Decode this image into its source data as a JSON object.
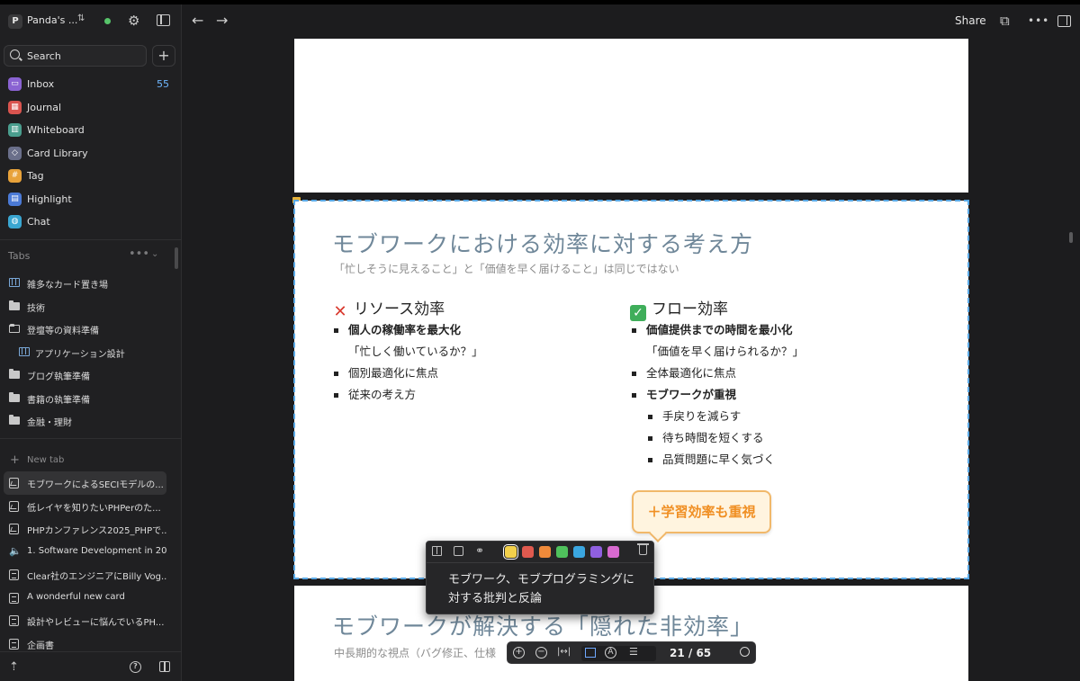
{
  "workspace": {
    "badge": "P",
    "name": "Panda's ...",
    "updown": "⇅",
    "status_color": "#57c46a"
  },
  "search": {
    "label": "Search",
    "add": "+"
  },
  "nav": [
    {
      "label": "Inbox",
      "icon": "inbox-icon",
      "color": "#8a63d2",
      "count": "55"
    },
    {
      "label": "Journal",
      "icon": "calendar-icon",
      "color": "#d9544f",
      "count": ""
    },
    {
      "label": "Whiteboard",
      "icon": "whiteboard-icon",
      "color": "#4a9e8e",
      "count": ""
    },
    {
      "label": "Card Library",
      "icon": "card-library-icon",
      "color": "#6a6f8a",
      "count": ""
    },
    {
      "label": "Tag",
      "icon": "tag-icon",
      "color": "#e8a23a",
      "count": ""
    },
    {
      "label": "Highlight",
      "icon": "highlight-icon",
      "color": "#4b7ad6",
      "count": ""
    },
    {
      "label": "Chat",
      "icon": "chat-icon",
      "color": "#3aa6d1",
      "count": ""
    }
  ],
  "tabs_section": {
    "title": "Tabs",
    "more": "•••",
    "collapse": "⌄"
  },
  "tabs": [
    {
      "label": "雑多なカード置き場",
      "kind": "map",
      "sub": false
    },
    {
      "label": "技術",
      "kind": "folder",
      "sub": false
    },
    {
      "label": "登壇等の資料準備",
      "kind": "folder-open",
      "sub": false
    },
    {
      "label": "アプリケーション設計",
      "kind": "map",
      "sub": true
    },
    {
      "label": "ブログ執筆準備",
      "kind": "folder",
      "sub": false
    },
    {
      "label": "書籍の執筆準備",
      "kind": "folder",
      "sub": false
    },
    {
      "label": "金融・理財",
      "kind": "folder",
      "sub": false
    }
  ],
  "new_tab": {
    "plus": "+",
    "label": "New tab"
  },
  "open_tabs": [
    {
      "label": "モブワークによるSECIモデルの...",
      "kind": "pic",
      "active": true
    },
    {
      "label": "低レイヤを知りたいPHPerのた...",
      "kind": "pic",
      "active": false
    },
    {
      "label": "PHPカンファレンス2025_PHPで...",
      "kind": "pic",
      "active": false
    },
    {
      "label": "1. Software Development in 20...",
      "kind": "speaker",
      "active": false
    },
    {
      "label": "Clear社のエンジニアにBilly Vog...",
      "kind": "doc",
      "active": false
    },
    {
      "label": "A wonderful new card",
      "kind": "doc",
      "active": false
    },
    {
      "label": "設計やレビューに悩んでいるPH...",
      "kind": "doc",
      "active": false
    },
    {
      "label": "企画書",
      "kind": "doc",
      "active": false
    }
  ],
  "topbar": {
    "back": "←",
    "forward": "→",
    "share": "Share",
    "more": "•••"
  },
  "slide": {
    "title": "モブワークにおける効率に対する考え方",
    "subtitle": "「忙しそうに見えること」と「価値を早く届けること」は同じではない",
    "left": {
      "mark": "✕",
      "heading": "リソース効率",
      "items": [
        {
          "text": "個人の稼働率を最大化",
          "style": "bold"
        },
        {
          "text": "「忙しく働いているか？」",
          "style": "plain"
        },
        {
          "text": "個別最適化に焦点",
          "style": ""
        },
        {
          "text": "従来の考え方",
          "style": ""
        }
      ]
    },
    "right": {
      "mark": "✓",
      "heading": "フロー効率",
      "items": [
        {
          "text": "価値提供までの時間を最小化",
          "style": "bold"
        },
        {
          "text": "「価値を早く届けられるか？」",
          "style": "plain"
        },
        {
          "text": "全体最適化に焦点",
          "style": ""
        },
        {
          "text": "モブワークが重視",
          "style": "bold"
        },
        {
          "text": "手戻りを減らす",
          "style": "sub2"
        },
        {
          "text": "待ち時間を短くする",
          "style": "sub2"
        },
        {
          "text": "品質問題に早く気づく",
          "style": "sub2"
        }
      ]
    },
    "callout": "＋学習効率も重視"
  },
  "next_slide": {
    "title": "モブワークが解決する「隠れた非効率」",
    "subtitle": "中長期的な視点（バグ修正、仕様"
  },
  "highlight_popup": {
    "text": "モブワーク、モブプログラミングに対する批判と反論",
    "colors": [
      "#f2d04b",
      "#e05a4f",
      "#ef8a3a",
      "#4fc15c",
      "#3aa6e0",
      "#8f5fe0",
      "#d86ad0"
    ],
    "selected_color": "#f2d04b"
  },
  "pdf_toolbar": {
    "zoom_in": "+",
    "zoom_out": "−",
    "fit_width": "|↔|",
    "page": "21 / 65"
  }
}
